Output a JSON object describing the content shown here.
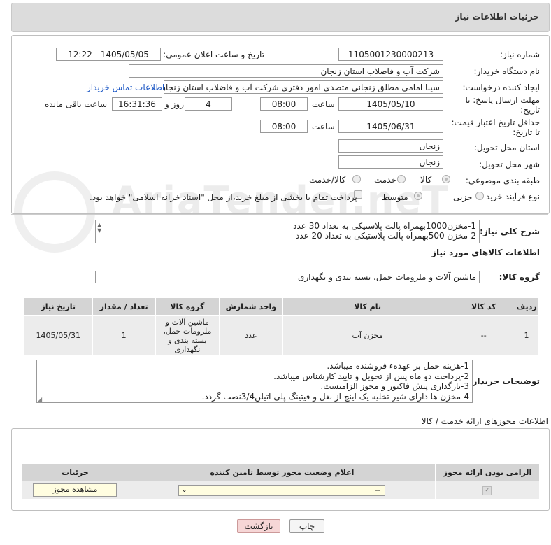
{
  "header": {
    "title": "جزئیات اطلاعات نیاز"
  },
  "form": {
    "need_number_label": "شماره نیاز:",
    "need_number": "1105001230000213",
    "announce_label": "تاریخ و ساعت اعلان عمومی:",
    "announce_value": "1405/05/05 - 12:22",
    "buyer_org_label": "نام دستگاه خریدار:",
    "buyer_org": "شرکت آب و فاضلاب استان زنجان",
    "creator_label": "ایجاد کننده درخواست:",
    "creator": "سینا امامی مطلق زنجانی متصدی امور دفتری شرکت آب و فاضلاب استان زنجان",
    "contact_link": "اطلاعات تماس خریدار",
    "deadline_label_1": "مهلت ارسال پاسخ: تا",
    "deadline_label_2": "تاریخ:",
    "deadline_date": "1405/05/10",
    "time_label": "ساعت",
    "deadline_time": "08:00",
    "days_value": "4",
    "days_label": "روز و",
    "remaining_time": "16:31:36",
    "remaining_label": "ساعت باقی مانده",
    "validity_label_1": "حداقل تاریخ اعتبار قیمت:",
    "validity_label_2": "تا تاریخ:",
    "validity_date": "1405/06/31",
    "validity_time_label": "ساعت",
    "validity_time": "08:00",
    "province_label": "استان محل تحویل:",
    "province": "زنجان",
    "city_label": "شهر محل تحویل:",
    "city": "زنجان",
    "category_label": "طبقه بندی موضوعی:",
    "category_options": [
      "کالا",
      "خدمت",
      "کالا/خدمت"
    ],
    "process_label": "نوع فرآیند خرید :",
    "process_options": [
      "جزیی",
      "متوسط"
    ],
    "payment_note": "پرداخت تمام یا بخشی از مبلغ خرید،از محل \"اسناد خزانه اسلامی\" خواهد بود."
  },
  "summary": {
    "label": "شرح کلی نیاز:",
    "lines": [
      "1-مخزن1000بهمراه پالت پلاستیکی به تعداد 30 عدد",
      "2-مخزن 500بهمراه پالت پلاستیکی به تعداد 20 عدد"
    ]
  },
  "goods": {
    "section_title": "اطلاعات کالاهای مورد نیاز",
    "group_label": "گروه کالا:",
    "group_value": "ماشین آلات و ملزومات حمل، بسته بندی و نگهداری",
    "columns": [
      "ردیف",
      "کد کالا",
      "نام کالا",
      "واحد شمارش",
      "گروه کالا",
      "تعداد / مقدار",
      "تاریخ نیاز"
    ],
    "rows": [
      {
        "row": "1",
        "code": "--",
        "name": "مخزن آب",
        "unit": "عدد",
        "group": "ماشین آلات و ملزومات حمل، بسته بندی و نگهداری",
        "qty": "1",
        "date": "1405/05/31"
      }
    ]
  },
  "buyer_notes": {
    "label": "توضیحات خریدار:",
    "lines": [
      "1-هزینه حمل بر عهدهء فروشنده میباشد.",
      "2-پرداخت دو ماه پس از تحویل و تایید کارشناس میباشد.",
      "3-بارگذاری پیش فاکتور و مجوز الزامیست.",
      "4-مخزن ها دارای شیر تخلیه یک اینچ از بغل و فیتینگ پلی اتیلن3/4نصب گردد."
    ]
  },
  "permits": {
    "section_title": "اطلاعات مجوزهای ارائه خدمت / کالا",
    "columns": [
      "الزامی بودن ارائه مجوز",
      "اعلام وضعیت مجوز توسط تامین کننده",
      "جزئیات"
    ],
    "select_value": "--",
    "view_button": "مشاهده مجوز"
  },
  "actions": {
    "print": "چاپ",
    "back": "بازگشت"
  },
  "watermark": "AriaTender.neT"
}
